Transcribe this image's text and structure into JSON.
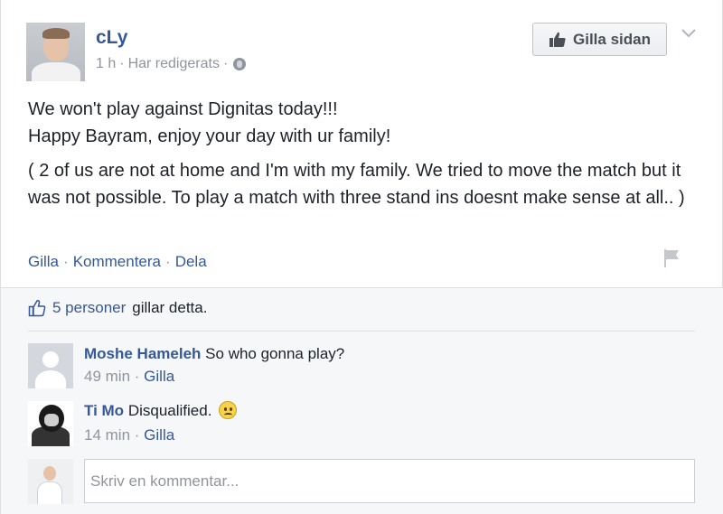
{
  "post": {
    "author": "cLy",
    "time": "1 h",
    "edited": "Har redigerats",
    "sep": "·",
    "like_page_label": "Gilla sidan",
    "text_line1": "We won't play against Dignitas today!!!",
    "text_line2": "Happy Bayram, enjoy your day with ur family!",
    "text_para2": "( 2 of us are not at home and I'm with my family. We tried to move the match but it was not possible. To play a match with three stand ins doesnt make sense at all.. )",
    "actions": {
      "like": "Gilla",
      "comment": "Kommentera",
      "share": "Dela"
    }
  },
  "likes": {
    "count_text": "5 personer",
    "rest_text": "gillar detta."
  },
  "comments": [
    {
      "author": "Moshe Hameleh",
      "text": "So who gonna play?",
      "time": "49 min",
      "like": "Gilla"
    },
    {
      "author": "Ti Mo",
      "text": "Disqualified.",
      "time": "14 min",
      "like": "Gilla"
    }
  ],
  "comment_input": {
    "placeholder": "Skriv en kommentar..."
  },
  "colors": {
    "link": "#365899",
    "meta": "#90949c",
    "text": "#1d2129",
    "feedback_bg": "#f6f7f9"
  },
  "icons": {
    "like_page": "thumbs-up-icon",
    "chevron": "chevron-down-icon",
    "globe": "globe-icon",
    "flag": "flag-icon",
    "likes": "thumbs-up-outline-icon",
    "emoji": "sad-face-icon"
  }
}
